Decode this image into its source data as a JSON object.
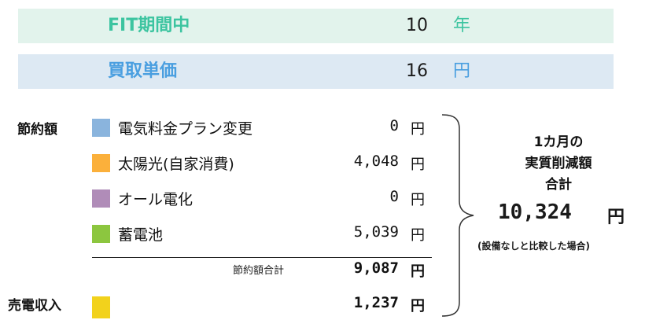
{
  "fit_period": {
    "label": "FIT期間中",
    "value": "10",
    "unit": "年",
    "color": "#3cc4a0"
  },
  "purchase_price": {
    "label": "買取単価",
    "value": "16",
    "unit": "円",
    "color": "#4a9fe0"
  },
  "savings": {
    "section_label": "節約額",
    "items": [
      {
        "name": "電気料金プラン変更",
        "value": "0",
        "unit": "円",
        "color": "#8ab4dd"
      },
      {
        "name": "太陽光(自家消費)",
        "value": "4,048",
        "unit": "円",
        "color": "#fbb03b"
      },
      {
        "name": "オール電化",
        "value": "0",
        "unit": "円",
        "color": "#b08cb8"
      },
      {
        "name": "蓄電池",
        "value": "5,039",
        "unit": "円",
        "color": "#8cc63f"
      }
    ],
    "subtotal_label": "節約額合計",
    "subtotal_value": "9,087",
    "subtotal_unit": "円"
  },
  "sales": {
    "section_label": "売電収入",
    "value": "1,237",
    "unit": "円",
    "color": "#f2d21c"
  },
  "summary": {
    "line1": "1カ月の",
    "line2": "実質削減額",
    "line3": "合計",
    "total": "10,324",
    "unit": "円",
    "note": "(設備なしと比較した場合)"
  }
}
